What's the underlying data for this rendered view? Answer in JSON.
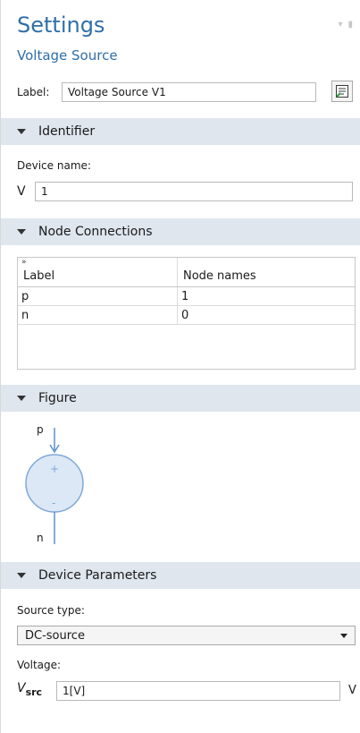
{
  "settings": {
    "title": "Settings",
    "subtitle": "Voltage Source",
    "label_caption": "Label:",
    "label_value": "Voltage Source V1"
  },
  "identifier": {
    "section_title": "Identifier",
    "device_name_caption": "Device name:",
    "prefix": "V",
    "device_name_value": "1"
  },
  "node_connections": {
    "section_title": "Node Connections",
    "columns": [
      "Label",
      "Node names"
    ],
    "rows": [
      {
        "label": "p",
        "node": "1"
      },
      {
        "label": "n",
        "node": "0"
      }
    ]
  },
  "figure": {
    "section_title": "Figure",
    "top_node": "p",
    "bottom_node": "n",
    "plus": "+",
    "minus": "-",
    "color": "#7ea8d8"
  },
  "device_parameters": {
    "section_title": "Device Parameters",
    "source_type_caption": "Source type:",
    "source_type_value": "DC-source",
    "voltage_caption": "Voltage:",
    "vsrc_symbol": "V",
    "vsrc_subscript": "src",
    "voltage_value": "1[V]",
    "unit": "V"
  },
  "colors": {
    "accent": "#2f6fa8",
    "section_bg": "#dfe6ee"
  }
}
